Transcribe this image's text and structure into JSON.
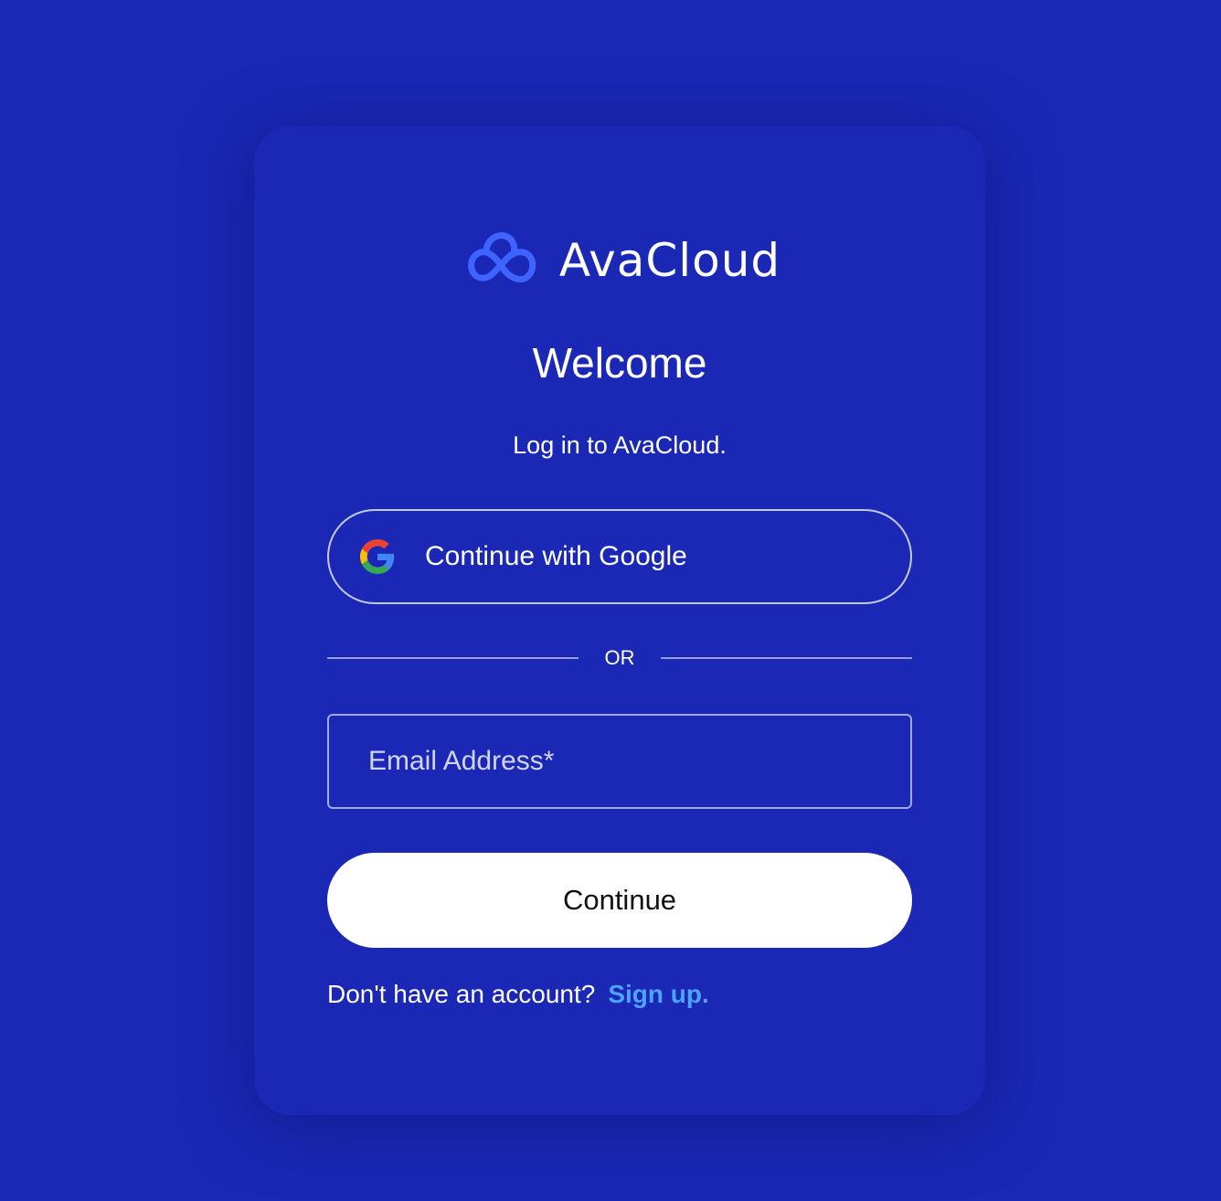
{
  "brand": {
    "name": "AvaCloud",
    "logo_icon": "cloud-infinity-icon",
    "logo_color": "#3f63ff"
  },
  "login": {
    "title": "Welcome",
    "subtitle": "Log in to AvaCloud.",
    "google_button_label": "Continue with Google",
    "google_icon": "google-icon",
    "divider_text": "OR",
    "email_placeholder": "Email Address*",
    "email_value": "",
    "continue_label": "Continue",
    "signup_prompt": "Don't have an account?",
    "signup_link": "Sign up."
  },
  "colors": {
    "background": "#1a28b5",
    "link": "#4ea3ff",
    "button_bg": "#ffffff"
  }
}
